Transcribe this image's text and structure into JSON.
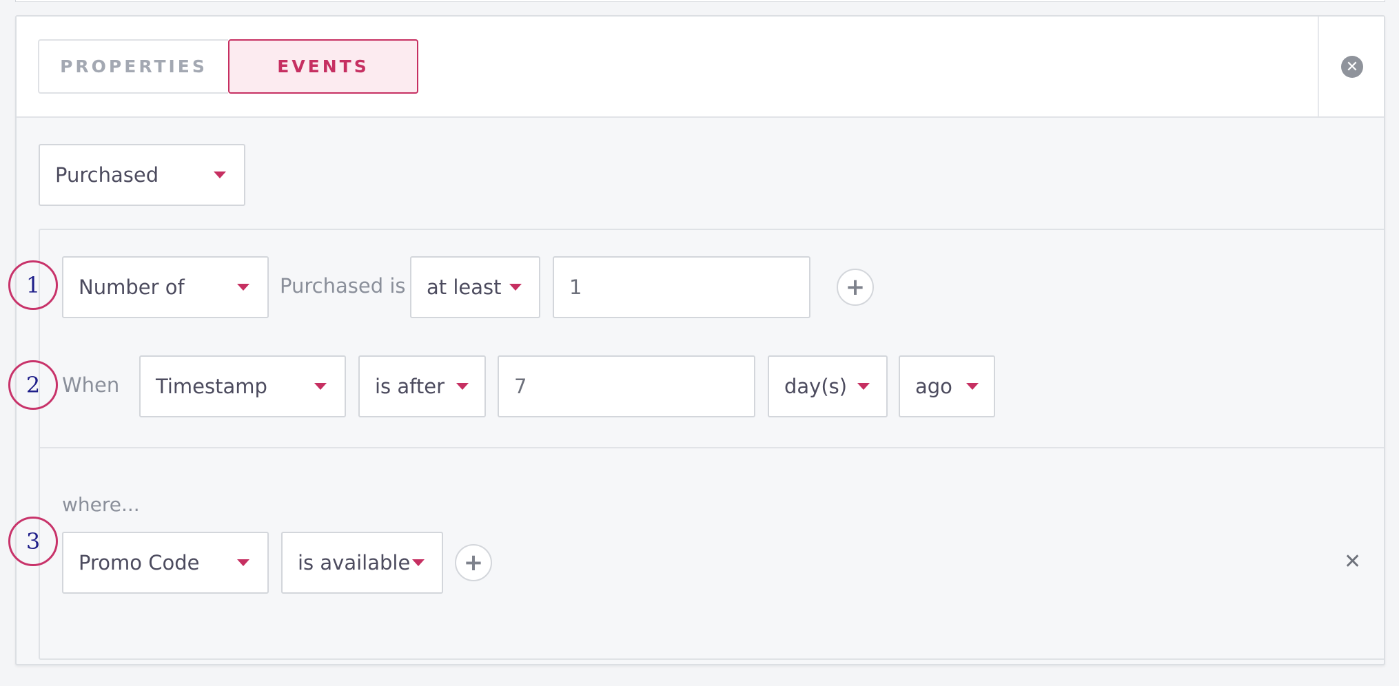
{
  "tabs": {
    "properties": "PROPERTIES",
    "events": "EVENTS"
  },
  "header": {
    "close_symbol": "✕"
  },
  "event_select": {
    "value": "Purchased"
  },
  "rule1": {
    "metric": "Number of",
    "label": "Purchased is",
    "operator": "at least",
    "value": "1",
    "add_symbol": "+"
  },
  "rule2": {
    "label": "When",
    "field": "Timestamp",
    "operator": "is after",
    "value": "7",
    "unit": "day(s)",
    "direction": "ago"
  },
  "where": {
    "label": "where...",
    "field": "Promo Code",
    "operator": "is available",
    "add_symbol": "+",
    "remove_symbol": "✕"
  },
  "badges": [
    "1",
    "2",
    "3"
  ],
  "colors": {
    "accent": "#c62f61",
    "badge_text": "#1f1f8a"
  }
}
